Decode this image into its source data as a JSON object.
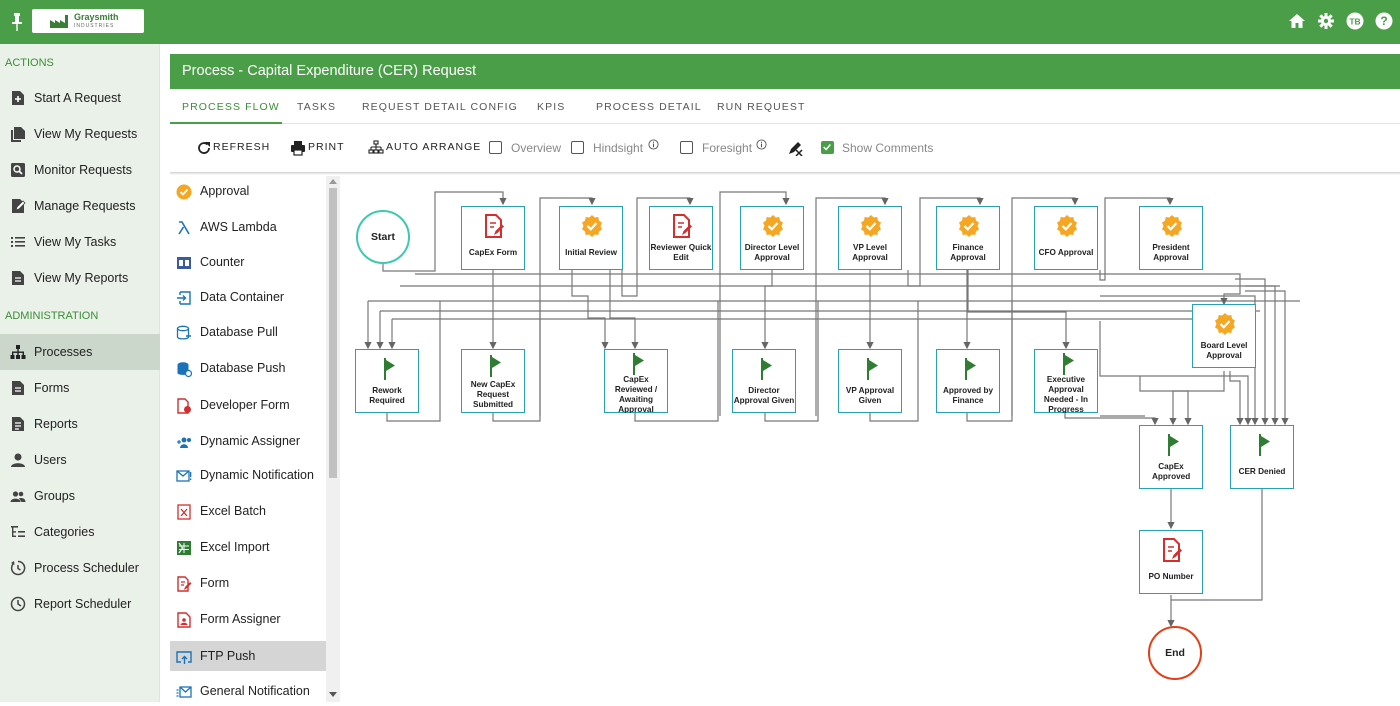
{
  "brand": {
    "name": "Graysmith",
    "sub": "INDUSTRIES"
  },
  "header": {
    "icons": [
      "home-icon",
      "gear-icon",
      "user-avatar",
      "help-icon"
    ],
    "avatar_initials": "TB"
  },
  "sidebar": {
    "actions_title": "ACTIONS",
    "actions": [
      {
        "label": "Start A Request",
        "icon": "start-request-icon"
      },
      {
        "label": "View My Requests",
        "icon": "requests-icon"
      },
      {
        "label": "Monitor Requests",
        "icon": "monitor-icon"
      },
      {
        "label": "Manage Requests",
        "icon": "manage-icon"
      },
      {
        "label": "View My Tasks",
        "icon": "tasks-icon"
      },
      {
        "label": "View My Reports",
        "icon": "reports-icon"
      }
    ],
    "admin_title": "ADMINISTRATION",
    "admin": [
      {
        "label": "Processes",
        "icon": "hierarchy-icon"
      },
      {
        "label": "Forms",
        "icon": "form-icon"
      },
      {
        "label": "Reports",
        "icon": "report-icon"
      },
      {
        "label": "Users",
        "icon": "user-icon"
      },
      {
        "label": "Groups",
        "icon": "group-icon"
      },
      {
        "label": "Categories",
        "icon": "categories-icon"
      },
      {
        "label": "Process Scheduler",
        "icon": "scheduler-icon"
      },
      {
        "label": "Report Scheduler",
        "icon": "clock-icon"
      }
    ]
  },
  "page": {
    "title": "Process - Capital Expenditure (CER) Request"
  },
  "tabs": [
    "PROCESS FLOW",
    "TASKS",
    "REQUEST DETAIL CONFIG",
    "KPIS",
    "PROCESS DETAIL",
    "RUN REQUEST"
  ],
  "toolbar": {
    "refresh": "REFRESH",
    "print": "PRINT",
    "auto_arrange": "AUTO ARRANGE",
    "overview": "Overview",
    "hindsight": "Hindsight",
    "foresight": "Foresight",
    "show_comments": "Show Comments"
  },
  "palette": [
    "Approval",
    "AWS Lambda",
    "Counter",
    "Data Container",
    "Database Pull",
    "Database Push",
    "Developer Form",
    "Dynamic Assigner",
    "Dynamic Notification",
    "Excel Batch",
    "Excel Import",
    "Form",
    "Form Assigner",
    "FTP Push",
    "General Notification"
  ],
  "flow": {
    "start": "Start",
    "end": "End",
    "nodes": {
      "capex_form": "CapEx Form",
      "initial_review": "Initial Review",
      "reviewer_quick_edit": "Reviewer Quick Edit",
      "director_level": "Director Level Approval",
      "vp_level": "VP Level Approval",
      "finance_approval": "Finance Approval",
      "cfo_approval": "CFO Approval",
      "president_approval": "President Approval",
      "board_level": "Board Level Approval",
      "rework_required": "Rework Required",
      "new_capex": "New CapEx Request Submitted",
      "capex_reviewed": "CapEx Reviewed / Awaiting Approval",
      "director_given": "Director Approval Given",
      "vp_given": "VP Approval Given",
      "approved_finance": "Approved by Finance",
      "executive_needed": "Executive Approval Needed - In Progress",
      "capex_approved": "CapEx Approved",
      "cer_denied": "CER Denied",
      "po_number": "PO Number"
    }
  }
}
